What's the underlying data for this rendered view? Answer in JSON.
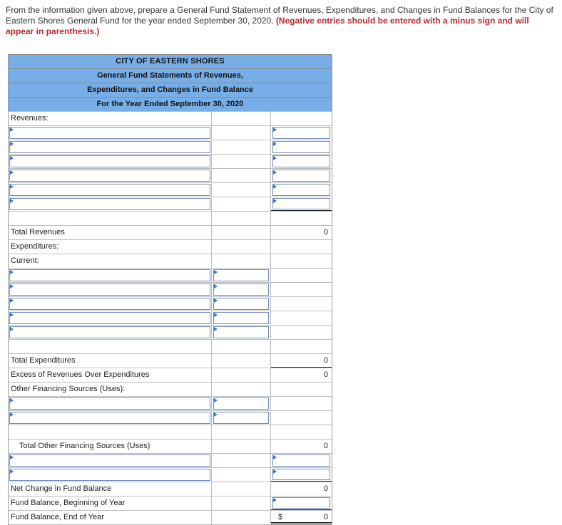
{
  "instructions": {
    "text": "From the information given above, prepare a General Fund Statement of Revenues, Expenditures, and Changes in Fund Balances for the City of Eastern Shores General Fund for the year ended September 30, 2020.",
    "note": "(Negative entries should be entered with a minus sign and will appear in parenthesis.)"
  },
  "header": {
    "line1": "CITY OF EASTERN SHORES",
    "line2": "General Fund Statements of Revenues,",
    "line3": "Expenditures, and Changes in Fund Balance",
    "line4": "For the Year Ended September 30, 2020"
  },
  "labels": {
    "revenues": "Revenues:",
    "total_revenues": "Total Revenues",
    "expenditures": "Expenditures:",
    "current": "Current:",
    "total_expenditures": "Total Expenditures",
    "excess": "Excess of Revenues Over Expenditures",
    "other_financing": "Other Financing Sources (Uses):",
    "total_other_financing": "Total Other Financing Sources (Uses)",
    "net_change": "Net Change in Fund Balance",
    "fb_beginning": "Fund Balance, Beginning of Year",
    "fb_end": "Fund Balance, End of Year"
  },
  "values": {
    "total_revenues": "0",
    "total_expenditures": "0",
    "excess": "0",
    "total_other_financing": "0",
    "net_change": "0",
    "fb_end": "0",
    "dollar_sign": "$"
  }
}
